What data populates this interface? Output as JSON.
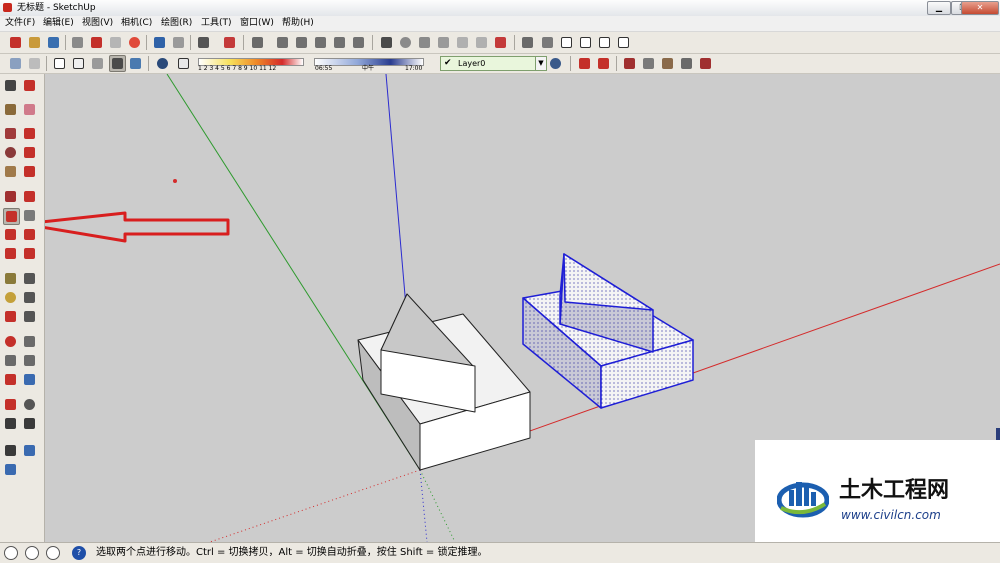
{
  "window": {
    "title": "无标题 - SketchUp",
    "minimize_glyph": "▁",
    "maximize_glyph": "❐",
    "close_glyph": "✕"
  },
  "menu": {
    "items": [
      "文件(F)",
      "编辑(E)",
      "视图(V)",
      "相机(C)",
      "绘图(R)",
      "工具(T)",
      "窗口(W)",
      "帮助(H)"
    ]
  },
  "toolbar": {
    "shadow_month_ticks": "1 2 3 4 5 6 7 8 9 10 11 12",
    "shadow_time_start": "06:55",
    "shadow_time_mid": "中午",
    "shadow_time_end": "17:00",
    "layer": {
      "check_glyph": "✔",
      "name": "Layer0",
      "dropdown_glyph": "▼"
    }
  },
  "tools": {
    "active": "move-tool",
    "icons": [
      "select-icon",
      "make-component-icon",
      "paint-bucket-icon",
      "eraser-icon",
      "rectangle-icon",
      "line-icon",
      "circle-icon",
      "freehand-icon",
      "polygon-icon",
      "arc-icon",
      "pie-icon",
      "two-point-arc-icon",
      "move-icon",
      "push-pull-icon",
      "rotate-icon",
      "follow-me-icon",
      "scale-icon",
      "offset-icon",
      "tape-measure-icon",
      "dimension-icon",
      "protractor-icon",
      "text-icon",
      "axes-icon",
      "3d-text-icon",
      "orbit-icon",
      "pan-icon",
      "zoom-icon",
      "zoom-window-icon",
      "zoom-extents-icon",
      "previous-view-icon",
      "position-camera-icon",
      "look-around-icon",
      "walk-icon",
      "section-plane-icon",
      "sandbox-icon",
      "smoove-icon",
      "stamp-icon"
    ]
  },
  "status": {
    "message": "选取两个点进行移动。Ctrl = 切换拷贝，Alt = 切换自动折叠，按住 Shift = 锁定推理。",
    "help_glyph": "?"
  },
  "watermark": {
    "title": "土木工程网",
    "url": "www.civilcn.com"
  },
  "colors": {
    "axis_red": "#d42b2b",
    "axis_green": "#2e9a2e",
    "axis_blue": "#2b2bd0",
    "selection_blue": "#1f1fd6",
    "annotation_arrow": "#d81e1e",
    "viewport_bg": "#cccccc"
  }
}
